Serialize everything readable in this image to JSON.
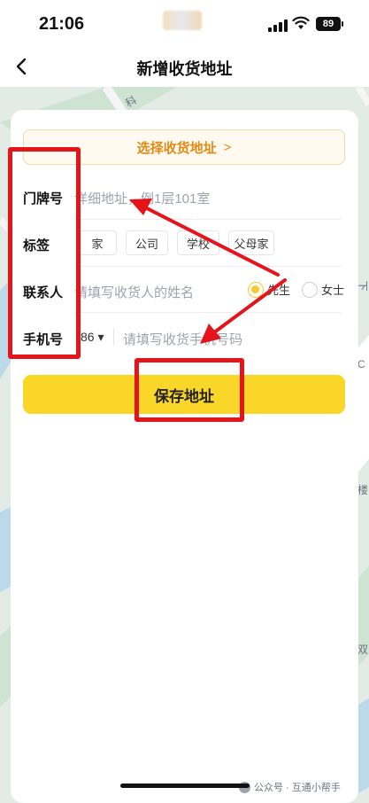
{
  "status_bar": {
    "time": "21:06",
    "battery": "89"
  },
  "nav": {
    "title": "新增收货地址"
  },
  "form": {
    "select_address_label": "选择收货地址",
    "select_address_chevron": ">",
    "door_number": {
      "label": "门牌号",
      "placeholder": "详细地址，例1层101室"
    },
    "tag": {
      "label": "标签",
      "options": [
        "家",
        "公司",
        "学校",
        "父母家"
      ]
    },
    "contact": {
      "label": "联系人",
      "placeholder": "请填写收货人的姓名",
      "options": [
        "先生",
        "女士"
      ],
      "selected": "先生"
    },
    "phone": {
      "label": "手机号",
      "country_code": "86 ▾",
      "placeholder": "请填写收货手机号码"
    },
    "save_label": "保存地址"
  },
  "map": {
    "labels": [
      "科",
      "C",
      "楼",
      "双",
      "下"
    ]
  },
  "watermark": "公众号 · 互通小帮手",
  "colors": {
    "accent_yellow": "#f9d628",
    "accent_orange": "#e38a16",
    "annotation_red": "#e5141b"
  }
}
